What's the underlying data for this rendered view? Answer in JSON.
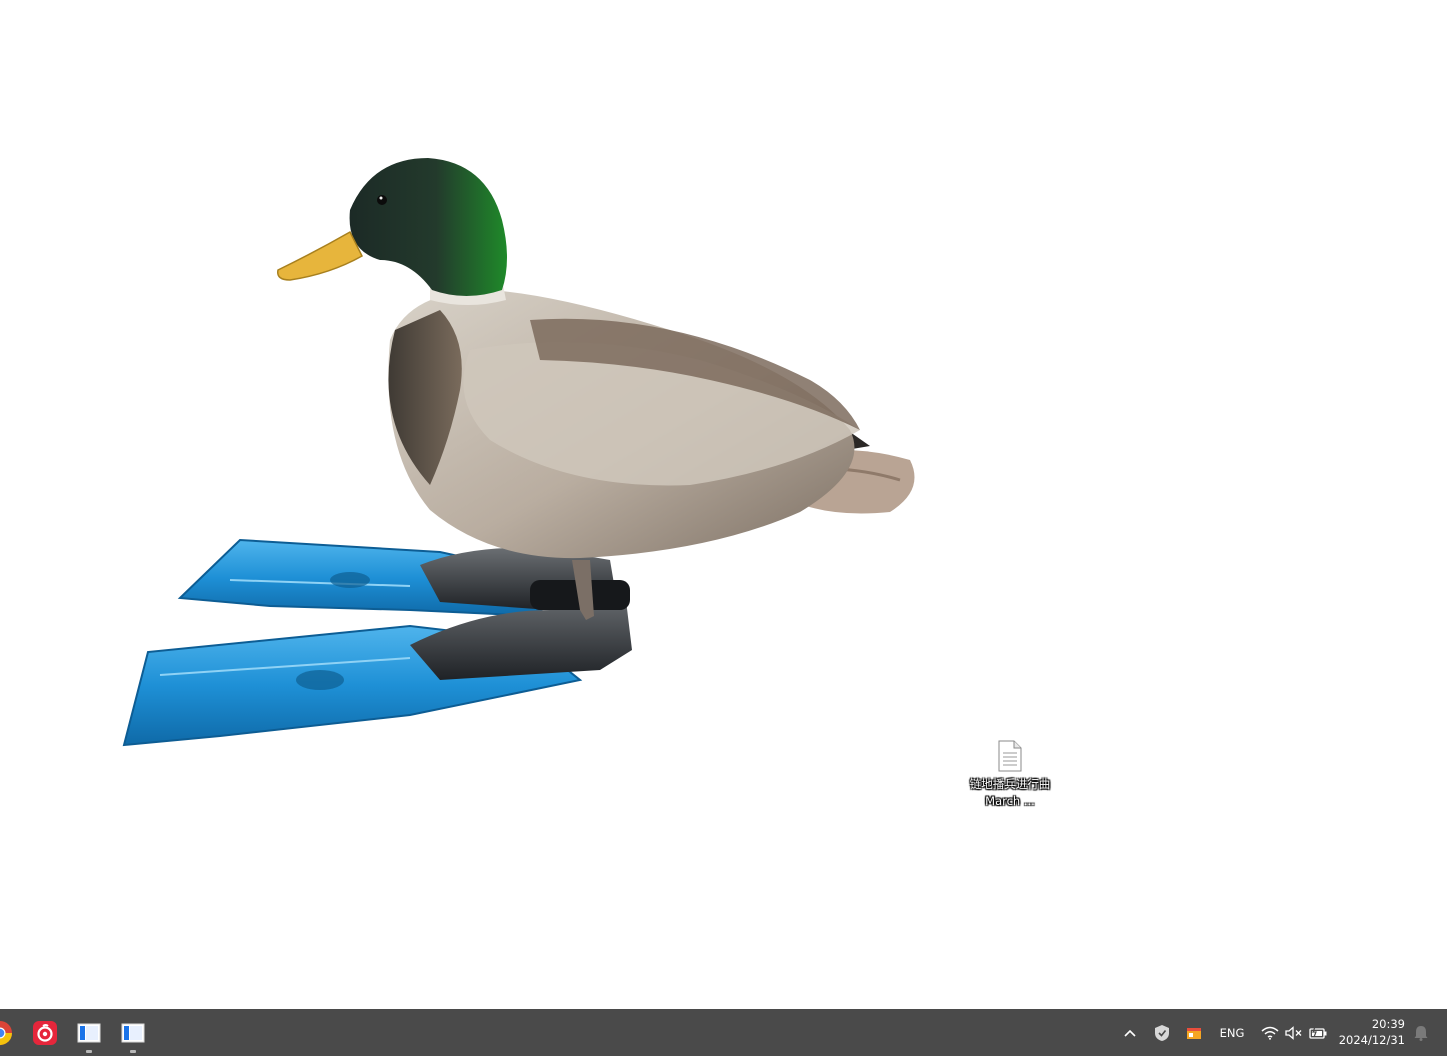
{
  "desktop": {
    "background": "#ffffff",
    "file_icon": {
      "label": "链地播兵进行曲 March ...",
      "icon": "text-document-icon"
    },
    "wallpaper": {
      "subject": "mallard-duck-with-swim-fins",
      "colors": {
        "head_green": "#1f8a2a",
        "bill": "#e7b53c",
        "fins": "#1e90d6"
      }
    }
  },
  "taskbar": {
    "background": "#4a4a4a",
    "apps": [
      {
        "name": "chrome-icon"
      },
      {
        "name": "netease-music-icon",
        "accent": "#e6263b"
      },
      {
        "name": "window-app-icon",
        "running": true
      },
      {
        "name": "window-app-icon",
        "running": true
      }
    ],
    "tray": {
      "show_hidden": "chevron-up-icon",
      "security": "shield-icon",
      "app_tray": "colorful-app-icon",
      "language": "ENG",
      "wifi": "wifi-icon",
      "volume": "speaker-muted-icon",
      "battery": "battery-charging-icon",
      "notifications": "notification-bell-icon"
    },
    "clock": {
      "time": "20:39",
      "date": "2024/12/31"
    }
  }
}
